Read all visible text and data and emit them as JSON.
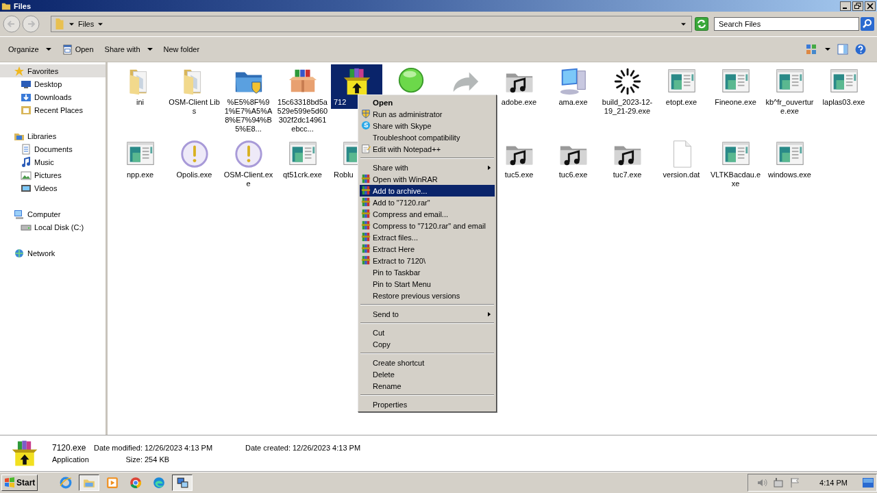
{
  "window": {
    "title": "Files"
  },
  "address": {
    "path": "Files",
    "search_placeholder": "Search Files"
  },
  "toolbar": [
    {
      "label": "Organize",
      "kind": "menu"
    },
    {
      "label": "Open",
      "kind": "icon"
    },
    {
      "label": "Share with",
      "kind": "menu"
    },
    {
      "label": "New folder",
      "kind": "plain"
    }
  ],
  "sidebar": [
    {
      "label": "Favorites",
      "kind": "star",
      "selected": true,
      "children": [
        {
          "label": "Desktop",
          "kind": "desktop",
          "selected": false
        },
        {
          "label": "Downloads",
          "kind": "download",
          "selected": false
        },
        {
          "label": "Recent Places",
          "kind": "recent",
          "selected": false
        }
      ]
    },
    {
      "label": "Libraries",
      "kind": "library",
      "selected": false,
      "children": [
        {
          "label": "Documents",
          "kind": "documents",
          "selected": false
        },
        {
          "label": "Music",
          "kind": "music",
          "selected": false
        },
        {
          "label": "Pictures",
          "kind": "pictures",
          "selected": false
        },
        {
          "label": "Videos",
          "kind": "videos",
          "selected": false
        }
      ]
    },
    {
      "label": "Computer",
      "kind": "computer",
      "selected": false,
      "children": [
        {
          "label": "Local Disk (C:)",
          "kind": "disk",
          "selected": false
        }
      ]
    },
    {
      "label": "Network",
      "kind": "network",
      "selected": false
    }
  ],
  "files": [
    {
      "kind": "folder",
      "label": "ini",
      "selected": false,
      "cut": false
    },
    {
      "kind": "folder",
      "label": "OSM-Client Libs",
      "selected": false,
      "cut": false
    },
    {
      "kind": "shield-folder",
      "label": "%E5%8F%91%E7%A5%A8%E7%94%B5%E8...",
      "selected": false,
      "cut": false
    },
    {
      "kind": "box",
      "label": "15c63318bd5a529e599e5d60302f2dc14961ebcc...",
      "selected": false,
      "cut": false
    },
    {
      "kind": "winrar",
      "label": "712",
      "selected": true,
      "cut": true
    },
    {
      "kind": "orb",
      "selected": false
    },
    {
      "kind": "arrow",
      "selected": false
    },
    {
      "kind": "music",
      "label": "adobe.exe",
      "selected": false,
      "cut": false
    },
    {
      "kind": "computer",
      "label": "ama.exe",
      "selected": false,
      "cut": false
    },
    {
      "kind": "spinner",
      "label": "build_2023-12-19_21-29.exe",
      "selected": false,
      "cut": false
    },
    {
      "kind": "app",
      "label": "etopt.exe",
      "selected": false,
      "cut": false
    },
    {
      "kind": "app",
      "label": "Fineone.exe",
      "selected": false,
      "cut": false
    },
    {
      "kind": "app",
      "label": "kb^fr_ouverture.exe",
      "selected": false,
      "cut": false
    },
    {
      "kind": "app",
      "label": "laplas03.exe",
      "selected": false,
      "cut": false
    },
    {
      "kind": "app",
      "label": "npp.exe",
      "selected": false,
      "cut": false
    },
    {
      "kind": "alert",
      "label": "Opolis.exe",
      "selected": false,
      "cut": false
    },
    {
      "kind": "alert",
      "label": "OSM-Client.exe",
      "selected": false,
      "cut": false
    },
    {
      "kind": "app",
      "label": "qt51crk.exe",
      "selected": false,
      "cut": false
    },
    {
      "kind": "app",
      "label": "Roblu",
      "selected": false,
      "cut": true
    },
    {
      "kind": "covered"
    },
    {
      "kind": "covered"
    },
    {
      "kind": "music",
      "label": "tuc5.exe",
      "selected": false,
      "cut": false
    },
    {
      "kind": "music",
      "label": "tuc6.exe",
      "selected": false,
      "cut": false
    },
    {
      "kind": "music",
      "label": "tuc7.exe",
      "selected": false,
      "cut": false
    },
    {
      "kind": "doc",
      "label": "version.dat",
      "selected": false,
      "cut": false
    },
    {
      "kind": "app",
      "label": "VLTKBacdau.exe",
      "selected": false,
      "cut": false
    },
    {
      "kind": "app",
      "label": "windows.exe",
      "selected": false,
      "cut": false
    }
  ],
  "context_menu": [
    {
      "kind": "default",
      "label": "Open",
      "highlighted": false
    },
    {
      "kind": "shield",
      "label": "Run as administrator",
      "highlighted": false
    },
    {
      "kind": "skype",
      "label": "Share with Skype",
      "highlighted": false
    },
    {
      "kind": "plain",
      "label": "Troubleshoot compatibility",
      "highlighted": false
    },
    {
      "kind": "notepad",
      "label": "Edit with Notepad++",
      "highlighted": false
    },
    {
      "kind": "separator"
    },
    {
      "kind": "submenu",
      "label": "Share with",
      "highlighted": false
    },
    {
      "kind": "winrar",
      "label": "Open with WinRAR",
      "highlighted": false
    },
    {
      "kind": "winrar",
      "label": "Add to archive...",
      "highlighted": true
    },
    {
      "kind": "winrar",
      "label": "Add to \"7120.rar\"",
      "highlighted": false
    },
    {
      "kind": "winrar",
      "label": "Compress and email...",
      "highlighted": false
    },
    {
      "kind": "winrar",
      "label": "Compress to \"7120.rar\" and email",
      "highlighted": false
    },
    {
      "kind": "winrar",
      "label": "Extract files...",
      "highlighted": false
    },
    {
      "kind": "winrar",
      "label": "Extract Here",
      "highlighted": false
    },
    {
      "kind": "winrar",
      "label": "Extract to 7120\\",
      "highlighted": false
    },
    {
      "kind": "plain",
      "label": "Pin to Taskbar",
      "highlighted": false
    },
    {
      "kind": "plain",
      "label": "Pin to Start Menu",
      "highlighted": false
    },
    {
      "kind": "plain",
      "label": "Restore previous versions",
      "highlighted": false
    },
    {
      "kind": "separator"
    },
    {
      "kind": "submenu",
      "label": "Send to",
      "highlighted": false
    },
    {
      "kind": "separator"
    },
    {
      "kind": "plain",
      "label": "Cut",
      "highlighted": false
    },
    {
      "kind": "plain",
      "label": "Copy",
      "highlighted": false
    },
    {
      "kind": "separator"
    },
    {
      "kind": "plain",
      "label": "Create shortcut",
      "highlighted": false
    },
    {
      "kind": "plain",
      "label": "Delete",
      "highlighted": false
    },
    {
      "kind": "plain",
      "label": "Rename",
      "highlighted": false
    },
    {
      "kind": "separator"
    },
    {
      "kind": "plain",
      "label": "Properties",
      "highlighted": false
    }
  ],
  "details": {
    "name": "7120.exe",
    "type": "Application",
    "fields": [
      {
        "label": "Date modified:",
        "value": "12/26/2023 4:13 PM"
      },
      {
        "label": "Date created:",
        "value": "12/26/2023 4:13 PM"
      },
      {
        "label": "Size:",
        "value": "254 KB"
      }
    ]
  },
  "taskbar": {
    "start": "Start",
    "apps": [
      {
        "kind": "ie",
        "active": false
      },
      {
        "kind": "explorer",
        "active": true
      },
      {
        "kind": "media",
        "active": false
      },
      {
        "kind": "chrome",
        "active": false
      },
      {
        "kind": "edge",
        "active": false
      },
      {
        "kind": "netapp",
        "active": true
      }
    ],
    "time": "4:14 PM"
  }
}
